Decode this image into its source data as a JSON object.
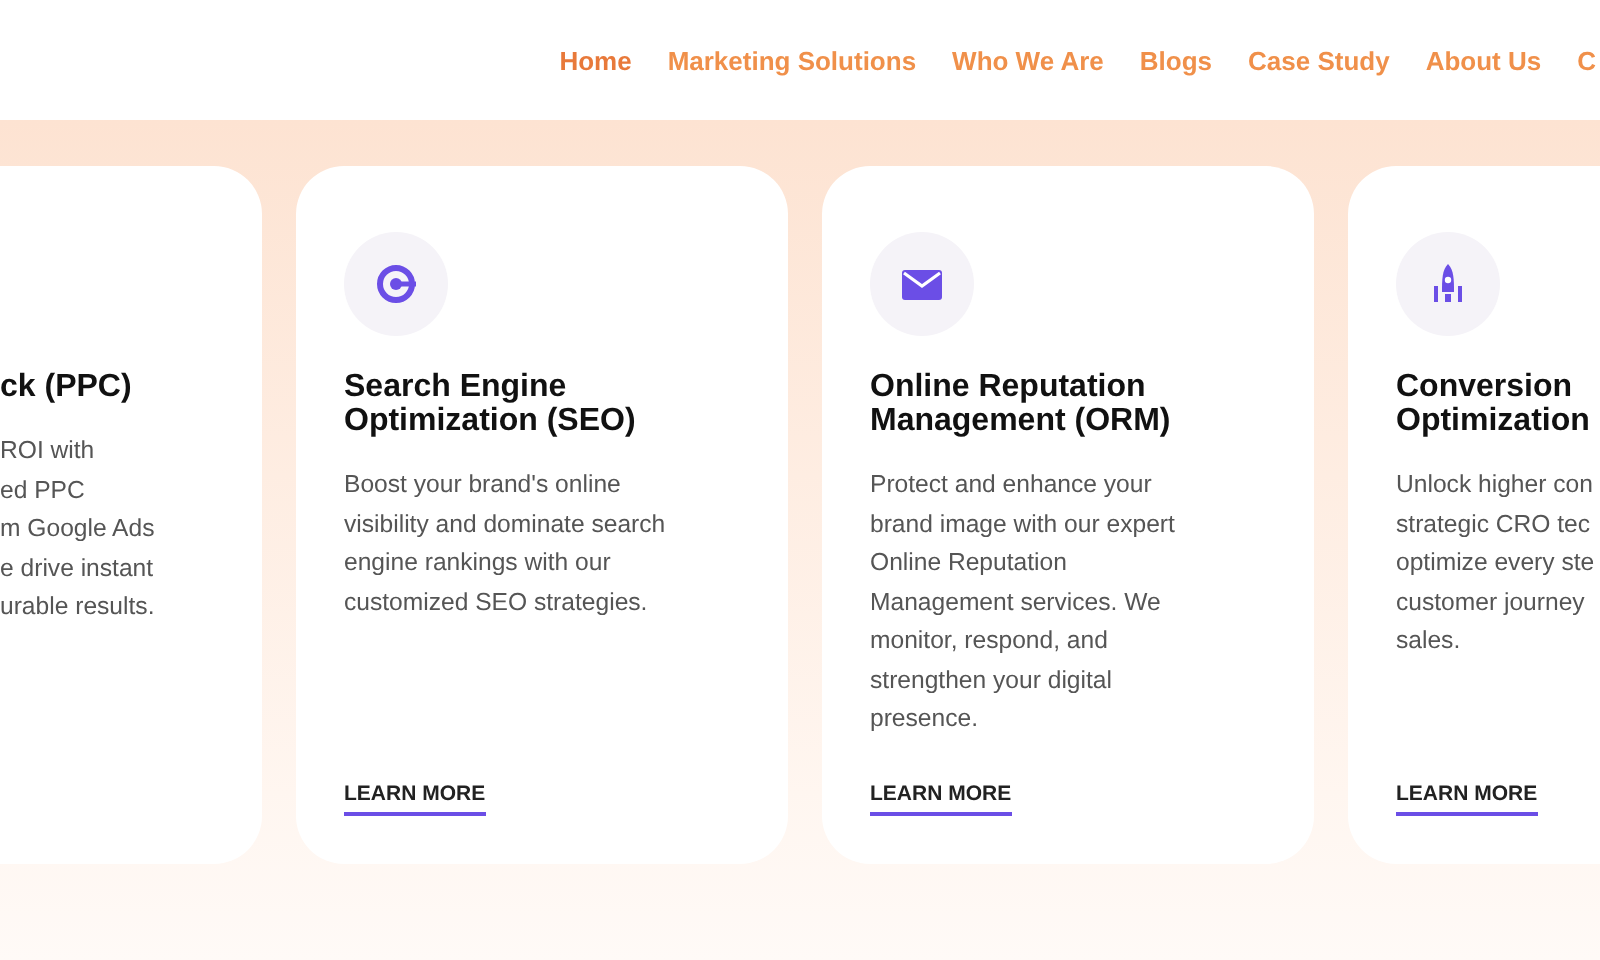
{
  "nav": [
    {
      "label": "Home",
      "selected": true
    },
    {
      "label": "Marketing Solutions",
      "selected": false
    },
    {
      "label": "Who We Are",
      "selected": false
    },
    {
      "label": "Blogs",
      "selected": false
    },
    {
      "label": "Case Study",
      "selected": false
    },
    {
      "label": "About Us",
      "selected": false
    },
    {
      "label": "C",
      "selected": false
    }
  ],
  "cards": [
    {
      "title": "ck (PPC)",
      "description": "ROI with\ned PPC\nm Google Ads\ne drive instant\nurable results."
    },
    {
      "title": "Search Engine\nOptimization (SEO)",
      "description": "Boost your brand's online\nvisibility and dominate search\nengine rankings with our\ncustomized SEO strategies.",
      "link": "LEARN MORE"
    },
    {
      "title": "Online Reputation\nManagement (ORM)",
      "description": "Protect and enhance your\nbrand image with our expert\nOnline Reputation\nManagement services. We\nmonitor, respond, and\nstrengthen your digital\npresence.",
      "link": "LEARN MORE"
    },
    {
      "title": "Conversion\nOptimization",
      "description": "Unlock higher con\nstrategic CRO tec\noptimize every ste\ncustomer journey\nsales.",
      "link": "LEARN MORE"
    }
  ]
}
